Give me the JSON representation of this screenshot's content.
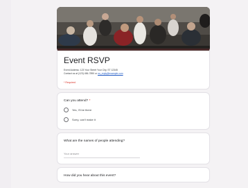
{
  "form": {
    "title": "Event RSVP",
    "address_line": "Event Address: 123 Your Street Your City, ST 12345",
    "contact_prefix": "Contact us at (123) 456-7890 or ",
    "contact_email": "no_reply@example.com",
    "required_note": "* Required"
  },
  "questions": [
    {
      "label": "Can you attend?",
      "required_mark": "*",
      "options": [
        "Yes, I'll be there",
        "Sorry, can't make it"
      ]
    },
    {
      "label": "What are the names of people attending?",
      "placeholder": "Your answer"
    },
    {
      "label": "How did you hear about this event?"
    }
  ],
  "colors": {
    "title_accent": "#4a2a2a",
    "link": "#1a56c4",
    "required": "#d93025",
    "background": "#f4f2f4"
  }
}
